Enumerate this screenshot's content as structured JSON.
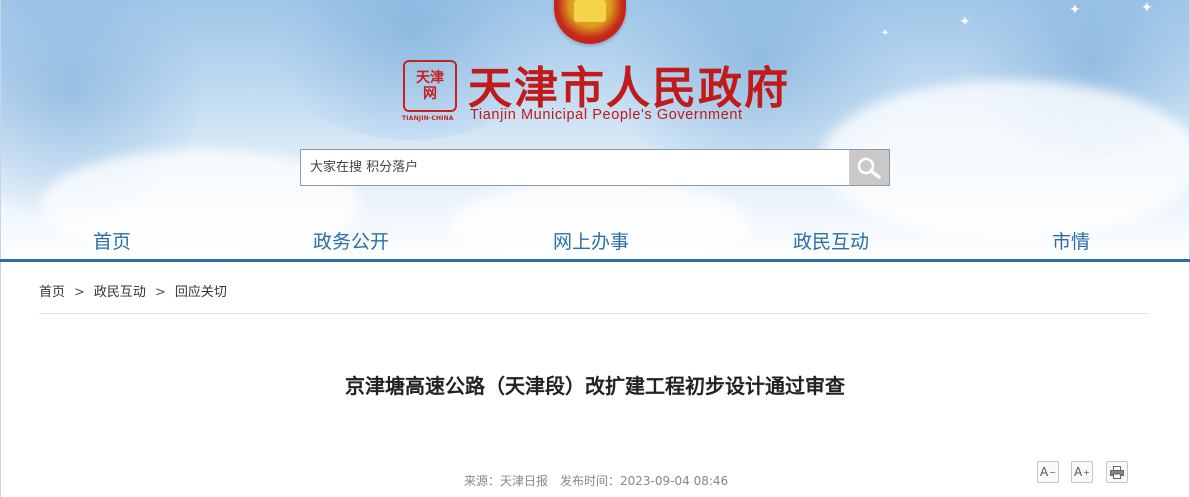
{
  "header": {
    "seal_text": "天津网",
    "seal_caption": "TIANJIN·CHINA",
    "title": "天津市人民政府",
    "subtitle": "Tianjin Municipal People's Government"
  },
  "search": {
    "placeholder": "大家在搜 积分落户",
    "icon": "search-icon"
  },
  "nav": {
    "items": [
      {
        "label": "首页"
      },
      {
        "label": "政务公开"
      },
      {
        "label": "网上办事"
      },
      {
        "label": "政民互动"
      },
      {
        "label": "市情"
      }
    ]
  },
  "breadcrumb": {
    "items": [
      "首页",
      "政民互动",
      "回应关切"
    ],
    "separator": ">"
  },
  "article": {
    "title": "京津塘高速公路（天津段）改扩建工程初步设计通过审查",
    "source": "来源：天津日报",
    "published": "发布时间：2023-09-04 08:46"
  },
  "tools": {
    "decrease_font": "A",
    "increase_font": "A",
    "print_icon": "print-icon"
  },
  "colors": {
    "brand_red": "#c01a19",
    "nav_blue": "#2a6fa8",
    "nav_bar": "#2b6ea7"
  }
}
